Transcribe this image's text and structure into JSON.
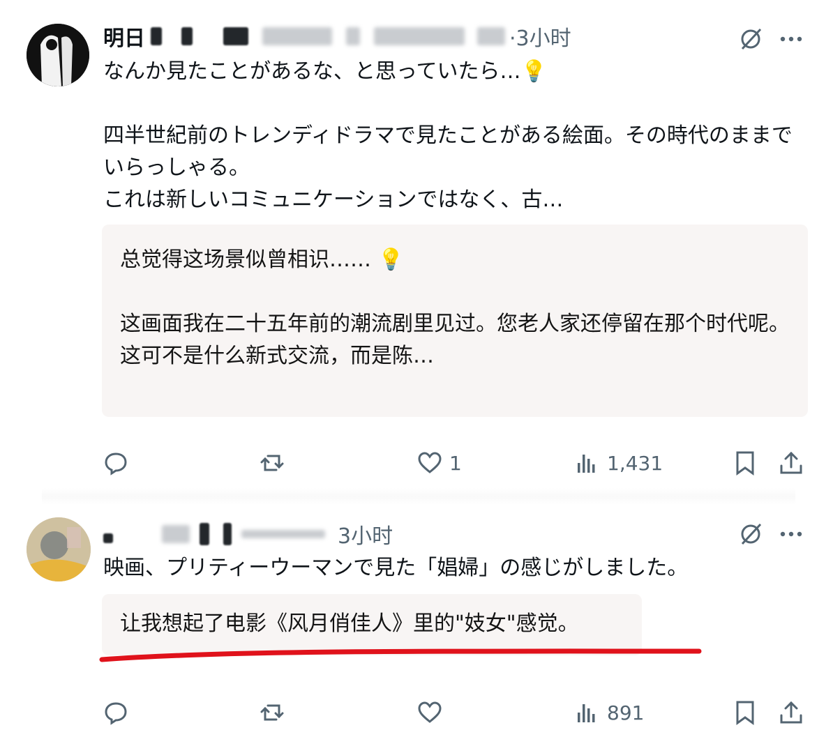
{
  "posts": [
    {
      "author_prefix": "明日",
      "meta": "·3小时",
      "text": "なんか見たことがあるな、と思っていたら…💡\n\n四半世紀前のトレンディドラマで見たことがある絵面。その時代のままでいらっしゃる。\nこれは新しいコミュニケーションではなく、古…",
      "translation": "总觉得这场景似曾相识…… 💡\n\n这画面我在二十五年前的潮流剧里见过。您老人家还停留在那个时代呢。\n这可不是什么新式交流，而是陈…",
      "likes": "1",
      "views": "1,431"
    },
    {
      "meta": "3小时",
      "text": "映画、プリティーウーマンで見た「娼婦」の感じがしました。",
      "translation": "让我想起了电影《风月俏佳人》里的\"妓女\"感觉。",
      "views": "891"
    }
  ],
  "icons": [
    "grok-icon",
    "more-icon",
    "reply-icon",
    "repost-icon",
    "like-icon",
    "views-icon",
    "bookmark-icon",
    "share-icon"
  ],
  "colors": {
    "text": "#0f1419",
    "secondary": "#536471",
    "translation_bg": "#f8f5f4",
    "underline": "#e0121b"
  }
}
